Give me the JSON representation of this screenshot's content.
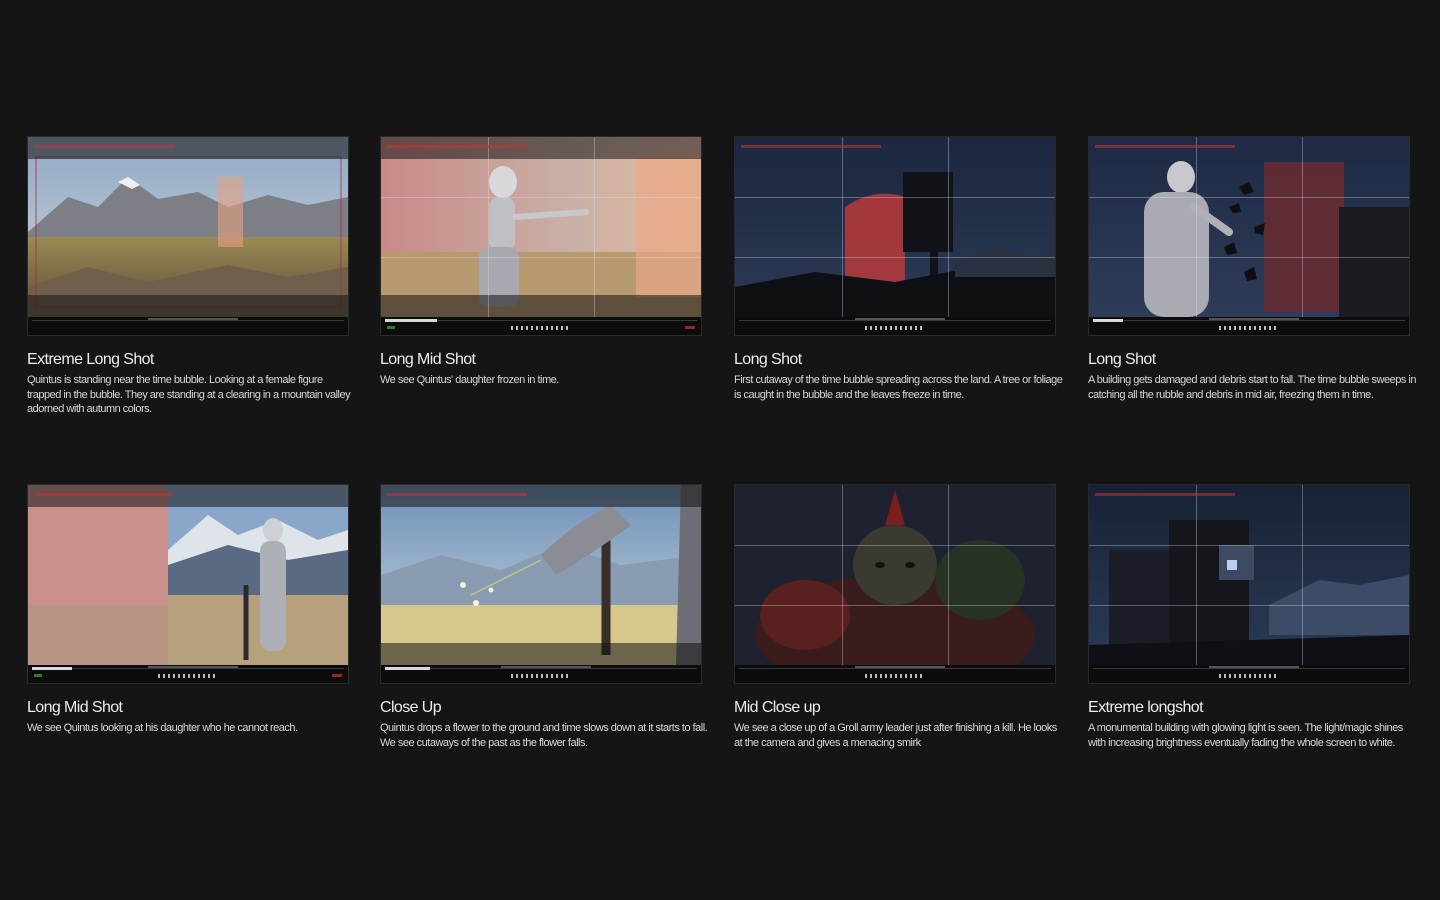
{
  "shots": [
    {
      "title": "Extreme Long Shot",
      "description": "Quintus is standing near the time bubble. Looking at a female figure trapped in the bubble. They are standing at a clearing in a mountain valley adorned with autumn colors.",
      "scene": "mountain-valley-bubble"
    },
    {
      "title": "Long Mid Shot",
      "description": "We see Quintus' daughter frozen in time.",
      "scene": "frozen-daughter"
    },
    {
      "title": "Long Shot",
      "description": "First cutaway of the time bubble spreading across the land. A tree or foliage is caught in the bubble and the leaves freeze in time.",
      "scene": "night-bubble-spreading"
    },
    {
      "title": "Long Shot",
      "description": "A building gets damaged and debris start to fall. The time bubble sweeps in catching all the rubble and debris in mid air, freezing them in time.",
      "scene": "debris-freeze"
    },
    {
      "title": "Long Mid Shot",
      "description": "We see Quintus looking at his daughter who he cannot reach.",
      "scene": "quintus-looking"
    },
    {
      "title": "Close Up",
      "description": "Quintus drops a flower to the ground and time slows down at it starts to fall. We see cutaways of the past as the flower falls.",
      "scene": "flower-drop"
    },
    {
      "title": "Mid Close up",
      "description": "We see a close up of a Groll army leader just after finishing a kill. He looks at the camera and gives a menacing smirk",
      "scene": "groll-leader"
    },
    {
      "title": "Extreme longshot",
      "description": "A monumental building with glowing light is seen. The light/magic shines with increasing brightness eventually fading the whole screen to white.",
      "scene": "monumental-building"
    }
  ],
  "colors": {
    "background": "#151515",
    "text": "#e6e6e6",
    "hud_red": "#c43a3a"
  }
}
